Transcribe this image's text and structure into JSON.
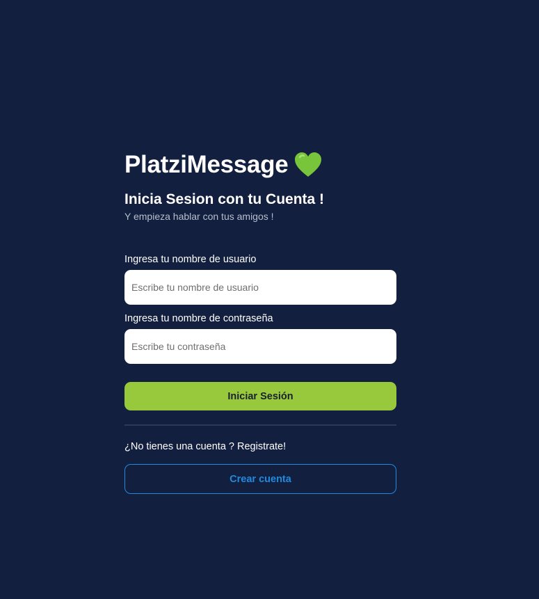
{
  "brand": {
    "title": "PlatziMessage",
    "icon": "green-heart-icon",
    "icon_color": "#78c43a"
  },
  "heading": "Inicia Sesion con tu Cuenta !",
  "subheading": "Y empieza hablar con tus amigos !",
  "form": {
    "username_label": "Ingresa tu nombre de usuario",
    "username_placeholder": "Escribe tu nombre de usuario",
    "username_value": "",
    "password_label": "Ingresa tu nombre de contraseña",
    "password_placeholder": "Escribe tu contraseña",
    "password_value": "",
    "login_label": "Iniciar Sesión"
  },
  "signup": {
    "prompt": "¿No tienes una cuenta ? Registrate!",
    "button_label": "Crear cuenta"
  },
  "colors": {
    "background": "#131f3f",
    "primary_button": "#98c93d",
    "secondary_accent": "#1f8ae0"
  }
}
